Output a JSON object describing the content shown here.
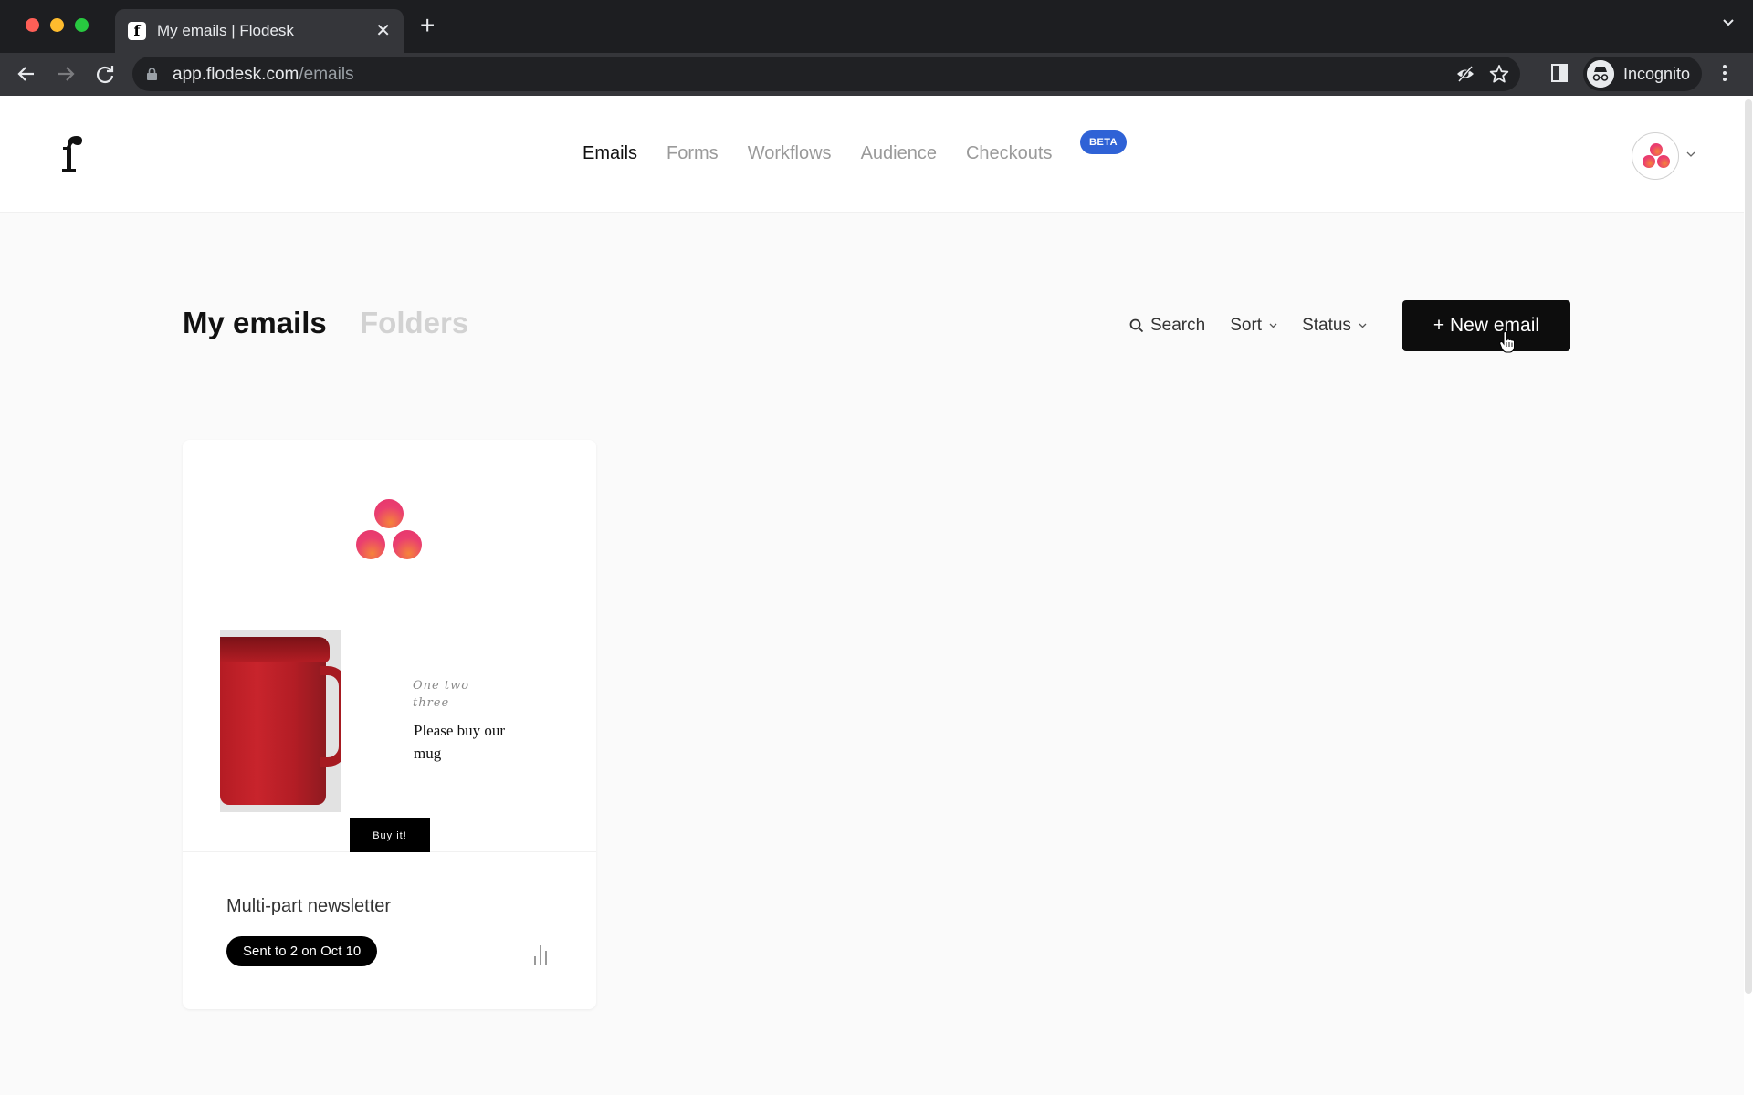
{
  "browser": {
    "tab": {
      "title": "My emails | Flodesk",
      "favicon": "flodesk-f-icon"
    },
    "url": {
      "host": "app.flodesk.com",
      "path": "/emails"
    },
    "profile_label": "Incognito",
    "icons": [
      "back-icon",
      "forward-icon",
      "reload-icon",
      "lock-icon",
      "eye-off-icon",
      "star-icon",
      "side-panel-icon",
      "incognito-icon",
      "more-icon",
      "tab-search-chevron-icon"
    ]
  },
  "header": {
    "logo": "flodesk-logo",
    "nav": [
      {
        "label": "Emails",
        "active": true
      },
      {
        "label": "Forms",
        "active": false
      },
      {
        "label": "Workflows",
        "active": false
      },
      {
        "label": "Audience",
        "active": false
      },
      {
        "label": "Checkouts",
        "active": false,
        "badge": "BETA"
      }
    ],
    "accent_color": "#2f62d6"
  },
  "main": {
    "title": "My emails",
    "secondary_tab": "Folders",
    "controls": {
      "search_label": "Search",
      "sort_label": "Sort",
      "status_label": "Status"
    },
    "new_email_label": "+ New email"
  },
  "emails": [
    {
      "name": "Multi-part newsletter",
      "status": "Sent to 2 on Oct 10",
      "preview": {
        "script_text": "One  two three",
        "body_text": "Please buy our mug",
        "button_label": "Buy it!"
      }
    }
  ]
}
